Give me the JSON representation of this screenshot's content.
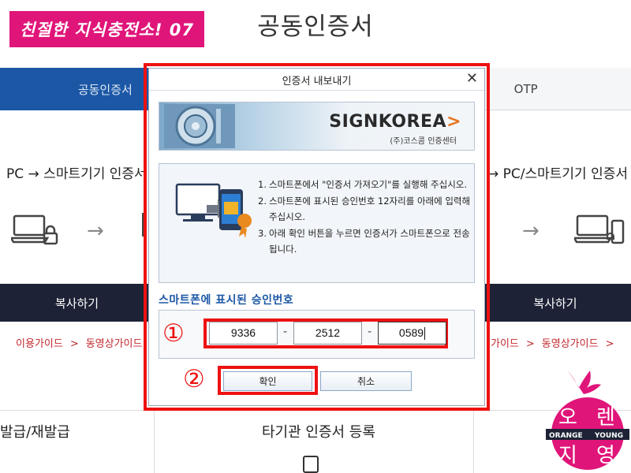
{
  "watermark": {
    "text": "친절한 지식충전소! 07"
  },
  "page": {
    "title": "공동인증서",
    "tabs": [
      {
        "label": "공동인증서",
        "active": true
      },
      {
        "label": "OTP",
        "active": false
      }
    ],
    "flow_left": "PC → 스마트기기 인증서",
    "flow_right": "→ PC/스마트기기 인증서",
    "copy_left": "복사하기",
    "copy_right": "복사하기",
    "guide": {
      "link1": "이용가이드",
      "link2": "동영상가이드",
      "sep": ">",
      "link3": "가이드",
      "link4": "동영상가이드"
    },
    "bottom_left": "발급/재발급",
    "bottom_center": "타기관 인증서 등록"
  },
  "dialog": {
    "title": "인증서 내보내기",
    "close_label": "✕",
    "banner": {
      "brand_main": "SIGNKOREA",
      "brand_chevron": ">",
      "brand_sub": "(주)코스콤 인증센터"
    },
    "instructions": [
      {
        "num": "1.",
        "text": "스마트폰에서 \"인증서 가져오기\"를 실행해 주십시오."
      },
      {
        "num": "2.",
        "text": "스마트폰에 표시된 승인번호 12자리를 아래에 입력해주십시오."
      },
      {
        "num": "3.",
        "text": "아래 확인 버튼을 누르면 인증서가 스마트폰으로 전송됩니다."
      }
    ],
    "code_label": "스마트폰에 표시된 승인번호",
    "code": [
      "9336",
      "2512",
      "0589"
    ],
    "code_sep": "-",
    "ok_label": "확인",
    "cancel_label": "취소"
  },
  "annotations": {
    "step1": "①",
    "step2": "②"
  },
  "logo": {
    "line1_a": "오",
    "line1_b": "렌",
    "line2_a": "지",
    "line2_b": "영",
    "ribbon_left": "ORANGE",
    "ribbon_right": "YOUNG"
  },
  "colors": {
    "accent_blue": "#1b57a5",
    "highlight_red": "#ee1111",
    "watermark_pink": "#e0157a",
    "dark_button": "#1d2236",
    "guide_red": "#c1272d"
  }
}
